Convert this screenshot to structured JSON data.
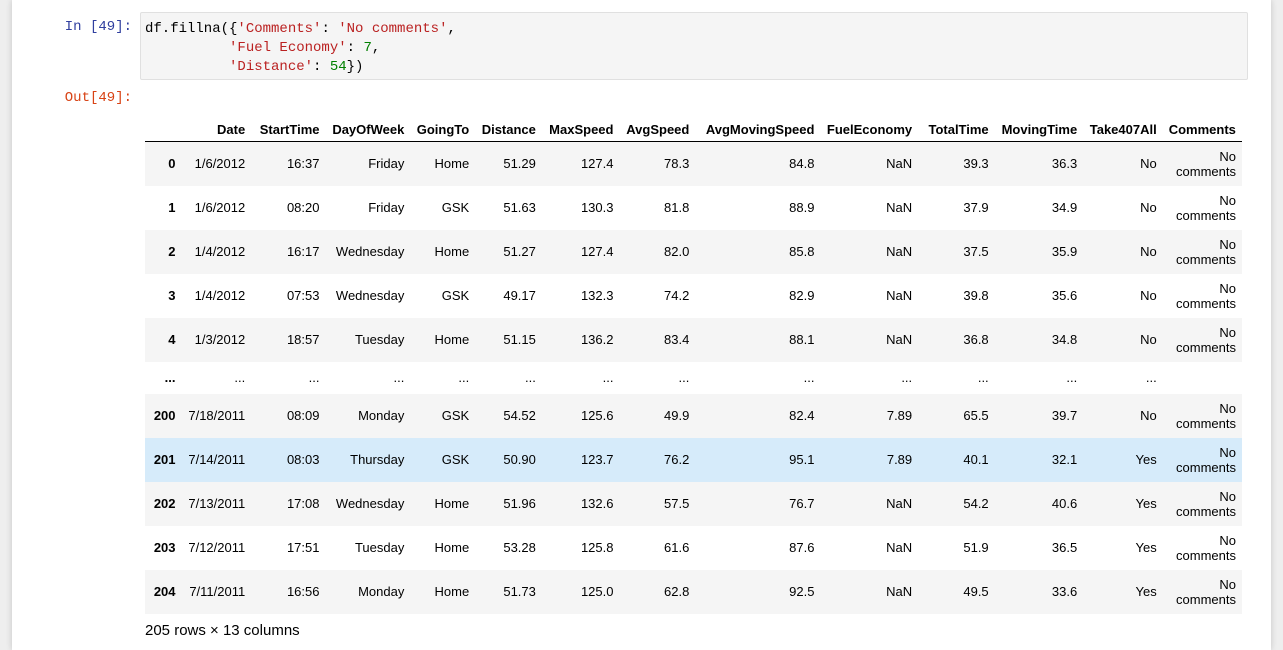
{
  "cells": {
    "input_prompt": "In [49]:",
    "output_prompt": "Out[49]:",
    "code_lines": [
      [
        {
          "t": "df.fillna({",
          "c": "plain"
        },
        {
          "t": "'Comments'",
          "c": "str"
        },
        {
          "t": ": ",
          "c": "plain"
        },
        {
          "t": "'No comments'",
          "c": "str"
        },
        {
          "t": ",",
          "c": "plain"
        }
      ],
      [
        {
          "t": "          ",
          "c": "plain"
        },
        {
          "t": "'Fuel Economy'",
          "c": "str"
        },
        {
          "t": ": ",
          "c": "plain"
        },
        {
          "t": "7",
          "c": "num"
        },
        {
          "t": ",",
          "c": "plain"
        }
      ],
      [
        {
          "t": "          ",
          "c": "plain"
        },
        {
          "t": "'Distance'",
          "c": "str"
        },
        {
          "t": ": ",
          "c": "plain"
        },
        {
          "t": "54",
          "c": "num"
        },
        {
          "t": "})",
          "c": "plain"
        }
      ]
    ]
  },
  "table": {
    "columns": [
      "",
      "Date",
      "StartTime",
      "DayOfWeek",
      "GoingTo",
      "Distance",
      "MaxSpeed",
      "AvgSpeed",
      "AvgMovingSpeed",
      "FuelEconomy",
      "TotalTime",
      "MovingTime",
      "Take407All",
      "Comments"
    ],
    "rows": [
      {
        "index": "0",
        "cells": [
          "1/6/2012",
          "16:37",
          "Friday",
          "Home",
          "51.29",
          "127.4",
          "78.3",
          "84.8",
          "NaN",
          "39.3",
          "36.3",
          "No",
          "No comments"
        ]
      },
      {
        "index": "1",
        "cells": [
          "1/6/2012",
          "08:20",
          "Friday",
          "GSK",
          "51.63",
          "130.3",
          "81.8",
          "88.9",
          "NaN",
          "37.9",
          "34.9",
          "No",
          "No comments"
        ]
      },
      {
        "index": "2",
        "cells": [
          "1/4/2012",
          "16:17",
          "Wednesday",
          "Home",
          "51.27",
          "127.4",
          "82.0",
          "85.8",
          "NaN",
          "37.5",
          "35.9",
          "No",
          "No comments"
        ]
      },
      {
        "index": "3",
        "cells": [
          "1/4/2012",
          "07:53",
          "Wednesday",
          "GSK",
          "49.17",
          "132.3",
          "74.2",
          "82.9",
          "NaN",
          "39.8",
          "35.6",
          "No",
          "No comments"
        ]
      },
      {
        "index": "4",
        "cells": [
          "1/3/2012",
          "18:57",
          "Tuesday",
          "Home",
          "51.15",
          "136.2",
          "83.4",
          "88.1",
          "NaN",
          "36.8",
          "34.8",
          "No",
          "No comments"
        ]
      },
      {
        "index": "...",
        "ellipsis": true,
        "cells": [
          "...",
          "...",
          "...",
          "...",
          "...",
          "...",
          "...",
          "...",
          "...",
          "...",
          "...",
          "...",
          ""
        ]
      },
      {
        "index": "200",
        "cells": [
          "7/18/2011",
          "08:09",
          "Monday",
          "GSK",
          "54.52",
          "125.6",
          "49.9",
          "82.4",
          "7.89",
          "65.5",
          "39.7",
          "No",
          "No comments"
        ]
      },
      {
        "index": "201",
        "highlight": true,
        "cells": [
          "7/14/2011",
          "08:03",
          "Thursday",
          "GSK",
          "50.90",
          "123.7",
          "76.2",
          "95.1",
          "7.89",
          "40.1",
          "32.1",
          "Yes",
          "No comments"
        ]
      },
      {
        "index": "202",
        "cells": [
          "7/13/2011",
          "17:08",
          "Wednesday",
          "Home",
          "51.96",
          "132.6",
          "57.5",
          "76.7",
          "NaN",
          "54.2",
          "40.6",
          "Yes",
          "No comments"
        ]
      },
      {
        "index": "203",
        "cells": [
          "7/12/2011",
          "17:51",
          "Tuesday",
          "Home",
          "53.28",
          "125.8",
          "61.6",
          "87.6",
          "NaN",
          "51.9",
          "36.5",
          "Yes",
          "No comments"
        ]
      },
      {
        "index": "204",
        "cells": [
          "7/11/2011",
          "16:56",
          "Monday",
          "Home",
          "51.73",
          "125.0",
          "62.8",
          "92.5",
          "NaN",
          "49.5",
          "33.6",
          "Yes",
          "No comments"
        ]
      }
    ],
    "summary": "205 rows × 13 columns"
  },
  "colors": {
    "input_prompt": "#303f9f",
    "output_prompt": "#d84315",
    "string": "#ba2121",
    "number": "#008000",
    "row_highlight": "#d6ebfa"
  }
}
